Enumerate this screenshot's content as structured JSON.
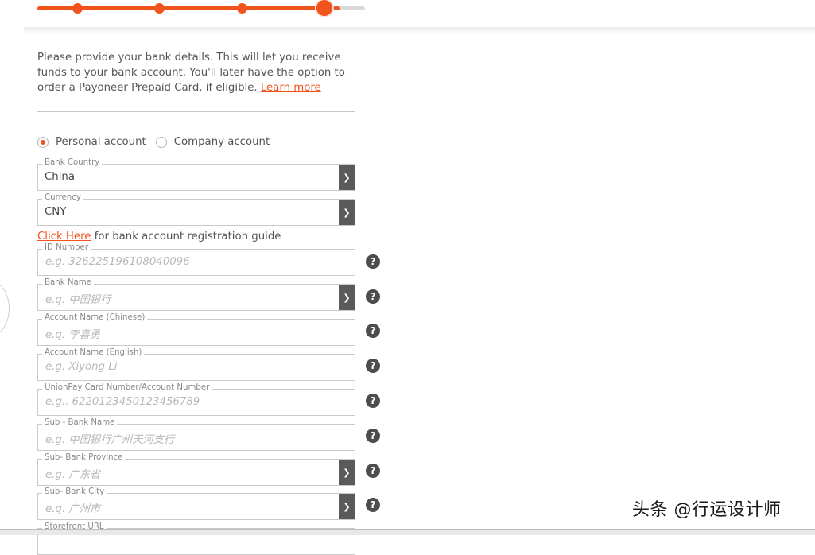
{
  "intro": {
    "text": "Please provide your bank details. This will let you receive funds to your bank account. You'll later have the option to order a Payoneer Prepaid Card, if eligible.",
    "learn_more": "Learn more"
  },
  "account_type": {
    "personal": "Personal account",
    "company": "Company account",
    "selected": "personal"
  },
  "bank_country": {
    "label": "Bank Country",
    "value": "China"
  },
  "currency": {
    "label": "Currency",
    "value": "CNY"
  },
  "guide": {
    "link": "Click Here",
    "text": " for bank account registration guide"
  },
  "id_number": {
    "label": "ID Number",
    "placeholder": "e.g. 326225196108040096"
  },
  "bank_name": {
    "label": "Bank Name",
    "placeholder": "e.g. 中国银行"
  },
  "account_name_cn": {
    "label": "Account Name (Chinese)",
    "placeholder": "e.g. 李喜勇"
  },
  "account_name_en": {
    "label": "Account Name (English)",
    "placeholder": "e.g. Xiyong Li"
  },
  "card_number": {
    "label": "UnionPay Card Number/Account Number",
    "placeholder": "e.g.. 6220123450123456789"
  },
  "sub_bank_name": {
    "label": "Sub - Bank Name",
    "placeholder": "e.g. 中国银行广州天河支行"
  },
  "sub_bank_province": {
    "label": "Sub- Bank Province",
    "placeholder": "e.g. 广东省"
  },
  "sub_bank_city": {
    "label": "Sub- Bank City",
    "placeholder": "e.g. 广州市"
  },
  "storefront_url": {
    "label": "Storefront URL"
  },
  "help_glyph": "?",
  "watermark": "头条 @行运设计师",
  "colors": {
    "accent": "#f0531c",
    "arrow_bg": "#5a5a5a",
    "help_bg": "#4d4d4d"
  },
  "progress": {
    "steps": 4,
    "current_step": 4
  }
}
